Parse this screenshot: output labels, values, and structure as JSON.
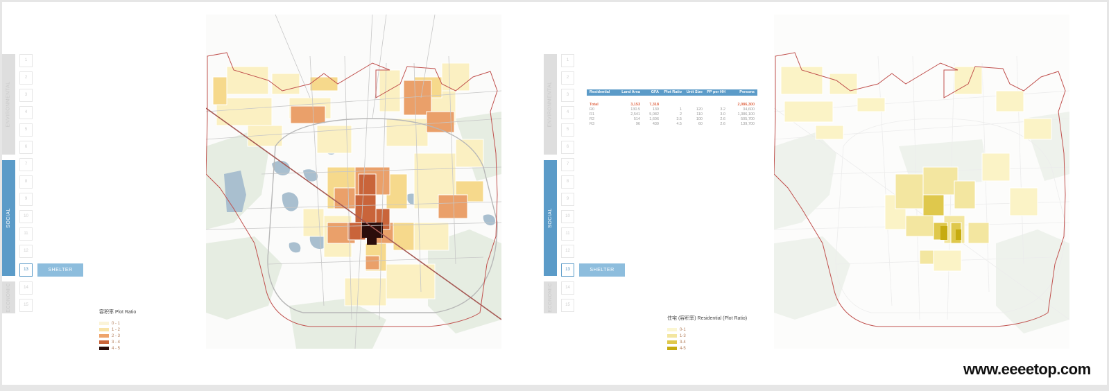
{
  "sidebar": {
    "numbers": [
      "1",
      "2",
      "3",
      "4",
      "5",
      "6",
      "7",
      "8",
      "9",
      "10",
      "11",
      "12",
      "13",
      "14",
      "15"
    ],
    "active_number": "13",
    "sections": [
      {
        "label": "ENVIRONMENTAL",
        "style": "gray"
      },
      {
        "label": "SOCIAL",
        "style": "blue"
      },
      {
        "label": "ECONOMIC",
        "style": "gray"
      }
    ],
    "active_label": "SHELTER"
  },
  "left_map": {
    "legend": {
      "title": "容积率 Plot Ratio",
      "items": [
        {
          "label": "0 - 1",
          "color": "#fbf4d8"
        },
        {
          "label": "1 - 2",
          "color": "#f8e3a6"
        },
        {
          "label": "2 - 3",
          "color": "#eea46b"
        },
        {
          "label": "3 - 4",
          "color": "#c9643a"
        },
        {
          "label": "4 - 5",
          "color": "#2b0d0b"
        }
      ]
    }
  },
  "right_map": {
    "legend": {
      "title": "住宅 (容积率) Residential (Plot Ratio)",
      "items": [
        {
          "label": "0-1",
          "color": "#fbf6d2"
        },
        {
          "label": "1-3",
          "color": "#f3e6a0"
        },
        {
          "label": "3-4",
          "color": "#dfc84c"
        },
        {
          "label": "4-5",
          "color": "#c6ab10"
        }
      ]
    }
  },
  "table": {
    "headers": [
      "Residential",
      "Land Area",
      "GFA",
      "Plot Ratio",
      "Unit Size",
      "PP per HH",
      "Persons"
    ],
    "total": [
      "Total",
      "3,153",
      "7,318",
      "",
      "",
      "",
      "2,086,300"
    ],
    "rows": [
      [
        "R0",
        "130.5",
        "130",
        "1",
        "120",
        "3.2",
        "34,600"
      ],
      [
        "R1",
        "2,541",
        "5,082",
        "2",
        "110",
        "3.0",
        "1,386,100"
      ],
      [
        "R2",
        "514",
        "1,606",
        "3.5",
        "100",
        "2.6",
        "505,700"
      ],
      [
        "R3",
        "96",
        "430",
        "4.5",
        "60",
        "2.6",
        "139,700"
      ]
    ]
  },
  "colors": {
    "accent_blue": "#5b9bc8",
    "boundary_red": "#c0504d",
    "water": "#9fb7c9"
  },
  "watermark": "www.eeeetop.com"
}
